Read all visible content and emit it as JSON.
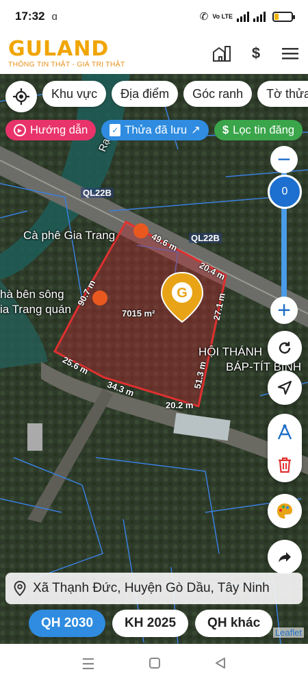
{
  "status_bar": {
    "time": "17:32",
    "network": "Vo LTE"
  },
  "header": {
    "brand": "GULAND",
    "tagline": "THÔNG TIN THẬT - GIÁ TRỊ THẬT"
  },
  "filters": {
    "chips": [
      "Khu vực",
      "Địa điểm",
      "Góc ranh",
      "Tờ thửa"
    ]
  },
  "quick_actions": {
    "guide": "Hướng dẫn",
    "saved": "Thửa đã lưu",
    "filter_news": "Lọc tin đăng"
  },
  "zoom": {
    "level": "0"
  },
  "map": {
    "roads": [
      "QL22B",
      "QL22B"
    ],
    "places": [
      "Cà phê Gia Trang",
      "hà bên sông",
      "ia Trang quán",
      "HỘI THÁNH",
      "BÁP-TÍT BÌNH"
    ],
    "river_label": "Rạch",
    "area": "7015 m²",
    "edges": [
      "49.6 m",
      "20.4 m",
      "27.1 m",
      "51.3 m",
      "20.2 m",
      "34.3 m",
      "25.6 m",
      "90.7 m"
    ]
  },
  "address": "Xã Thạnh Đức, Huyện Gò Dầu, Tây Ninh",
  "plan_tabs": [
    "QH 2030",
    "KH 2025",
    "QH khác"
  ],
  "attribution": "Leaflet",
  "colors": {
    "brand": "#f0a500",
    "accent_blue": "#2f8ce0",
    "plot_red": "#e03030",
    "pin_orange": "#e8a317"
  }
}
